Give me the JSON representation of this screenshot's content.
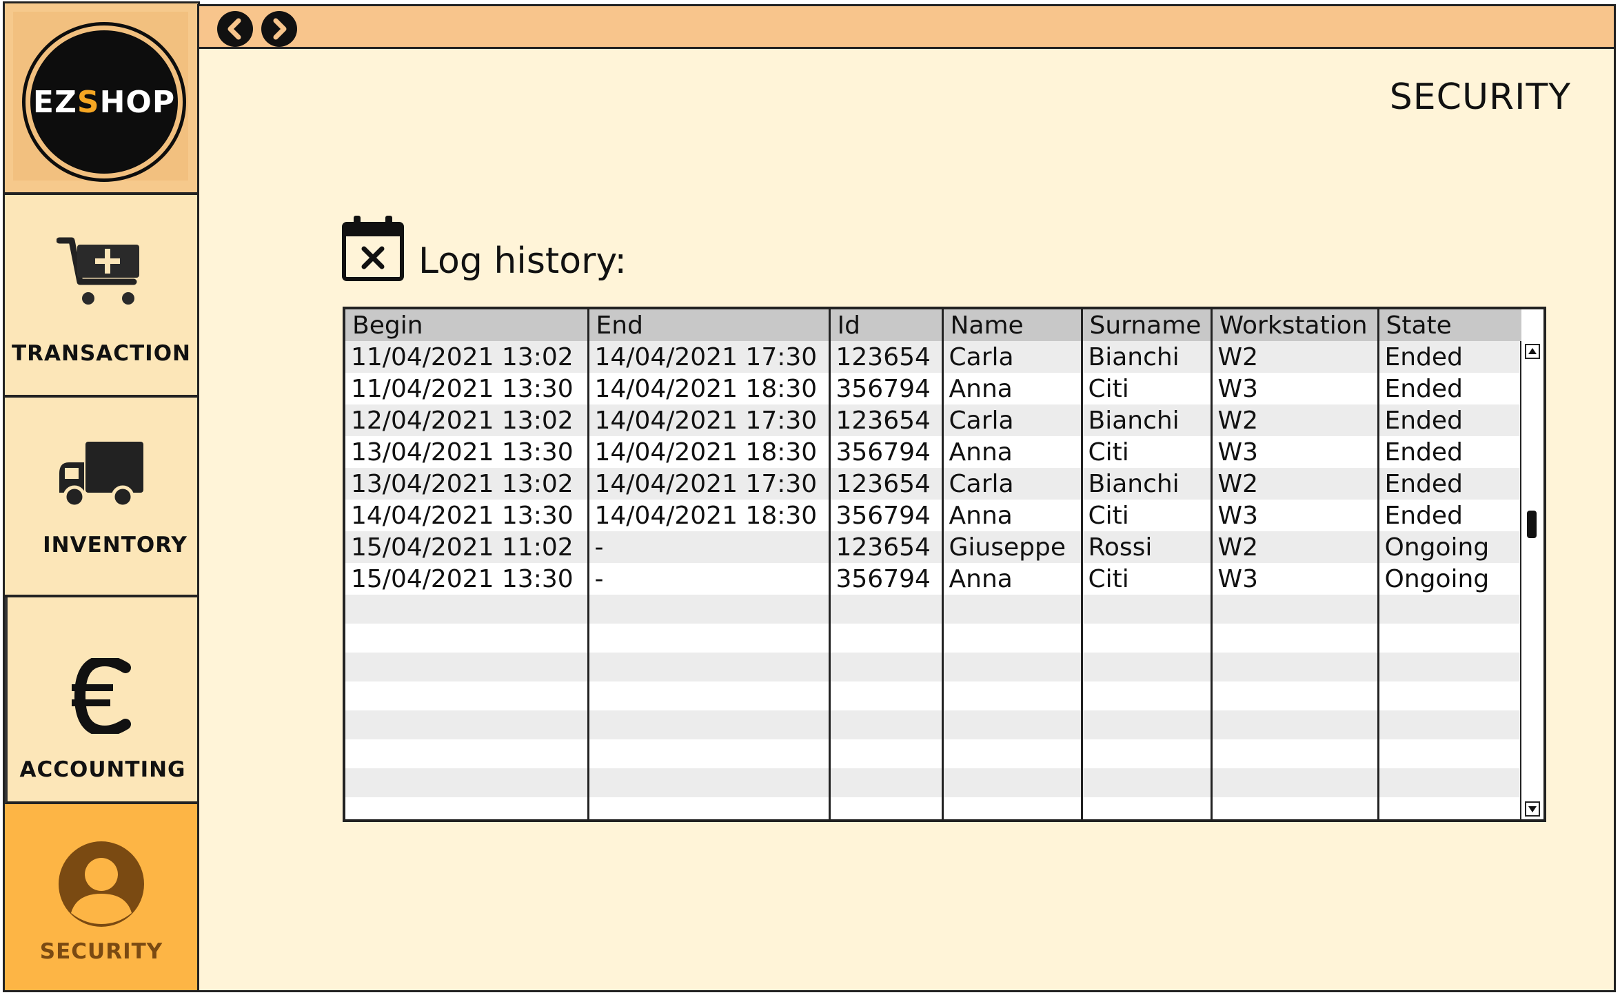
{
  "logo": {
    "part1": "EZ",
    "part2": "S",
    "part3": "HOP"
  },
  "sidebar": {
    "items": [
      {
        "label": "TRANSACTION",
        "icon": "cart-plus-icon"
      },
      {
        "label": "INVENTORY",
        "icon": "truck-icon"
      },
      {
        "label": "ACCOUNTING",
        "icon": "euro-icon"
      },
      {
        "label": "SECURITY",
        "icon": "user-icon",
        "active": true
      }
    ]
  },
  "page": {
    "title": "SECURITY",
    "section_title": "Log history:",
    "section_icon": "calendar-x-icon"
  },
  "table": {
    "columns": [
      "Begin",
      "End",
      "Id",
      "Name",
      "Surname",
      "Workstation",
      "State"
    ],
    "rows": [
      [
        "11/04/2021 13:02",
        "14/04/2021 17:30",
        "123654",
        "Carla",
        "Bianchi",
        "W2",
        "Ended"
      ],
      [
        "11/04/2021 13:30",
        "14/04/2021 18:30",
        "356794",
        "Anna",
        "Citi",
        "W3",
        "Ended"
      ],
      [
        "12/04/2021 13:02",
        "14/04/2021 17:30",
        "123654",
        "Carla",
        "Bianchi",
        "W2",
        "Ended"
      ],
      [
        "13/04/2021 13:30",
        "14/04/2021 18:30",
        "356794",
        "Anna",
        "Citi",
        "W3",
        "Ended"
      ],
      [
        "13/04/2021 13:02",
        "14/04/2021 17:30",
        "123654",
        "Carla",
        "Bianchi",
        "W2",
        "Ended"
      ],
      [
        "14/04/2021 13:30",
        "14/04/2021 18:30",
        "356794",
        "Anna",
        "Citi",
        "W3",
        "Ended"
      ],
      [
        "15/04/2021 11:02",
        "-",
        "123654",
        "Giuseppe",
        "Rossi",
        "W2",
        "Ongoing"
      ],
      [
        "15/04/2021 13:30",
        "-",
        "356794",
        "Anna",
        "Citi",
        "W3",
        "Ongoing"
      ]
    ]
  },
  "colors": {
    "sidebar_bg": "#fce6b8",
    "active_nav": "#fdb545",
    "titlebar": "#f8c58c",
    "window_bg": "#fff4d8",
    "logo_accent": "#f5a623"
  }
}
